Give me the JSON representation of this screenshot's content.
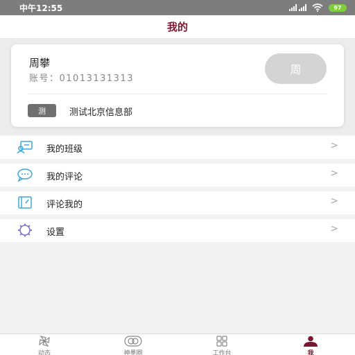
{
  "status_bar": {
    "time": "中午12:55",
    "battery": "97"
  },
  "header": {
    "title": "我的"
  },
  "profile": {
    "name": "周攀",
    "account_label": "账号：",
    "account_number": "01013131313",
    "avatar_text": "周",
    "org_badge": "测",
    "org_name": "测试北京信息部"
  },
  "menu": [
    {
      "label": "我的班级",
      "icon": "class-icon",
      "chevron": ">"
    },
    {
      "label": "我的评论",
      "icon": "chat-bubble-icon",
      "chevron": ">"
    },
    {
      "label": "评论我的",
      "icon": "notebook-icon",
      "chevron": ">"
    },
    {
      "label": "设置",
      "icon": "gear-icon",
      "chevron": ">"
    }
  ],
  "bottom_nav": [
    {
      "label": "动态",
      "icon": "pinwheel-icon",
      "active": false
    },
    {
      "label": "神墨圈",
      "icon": "circles-icon",
      "active": false
    },
    {
      "label": "工作台",
      "icon": "grid-icon",
      "active": false
    },
    {
      "label": "我",
      "icon": "person-icon",
      "active": true
    }
  ],
  "colors": {
    "accent": "#7a1730",
    "icon_blue": "#3aa8d8",
    "icon_purple": "#7b6fd0",
    "status_bar": "#7d7d7d"
  }
}
